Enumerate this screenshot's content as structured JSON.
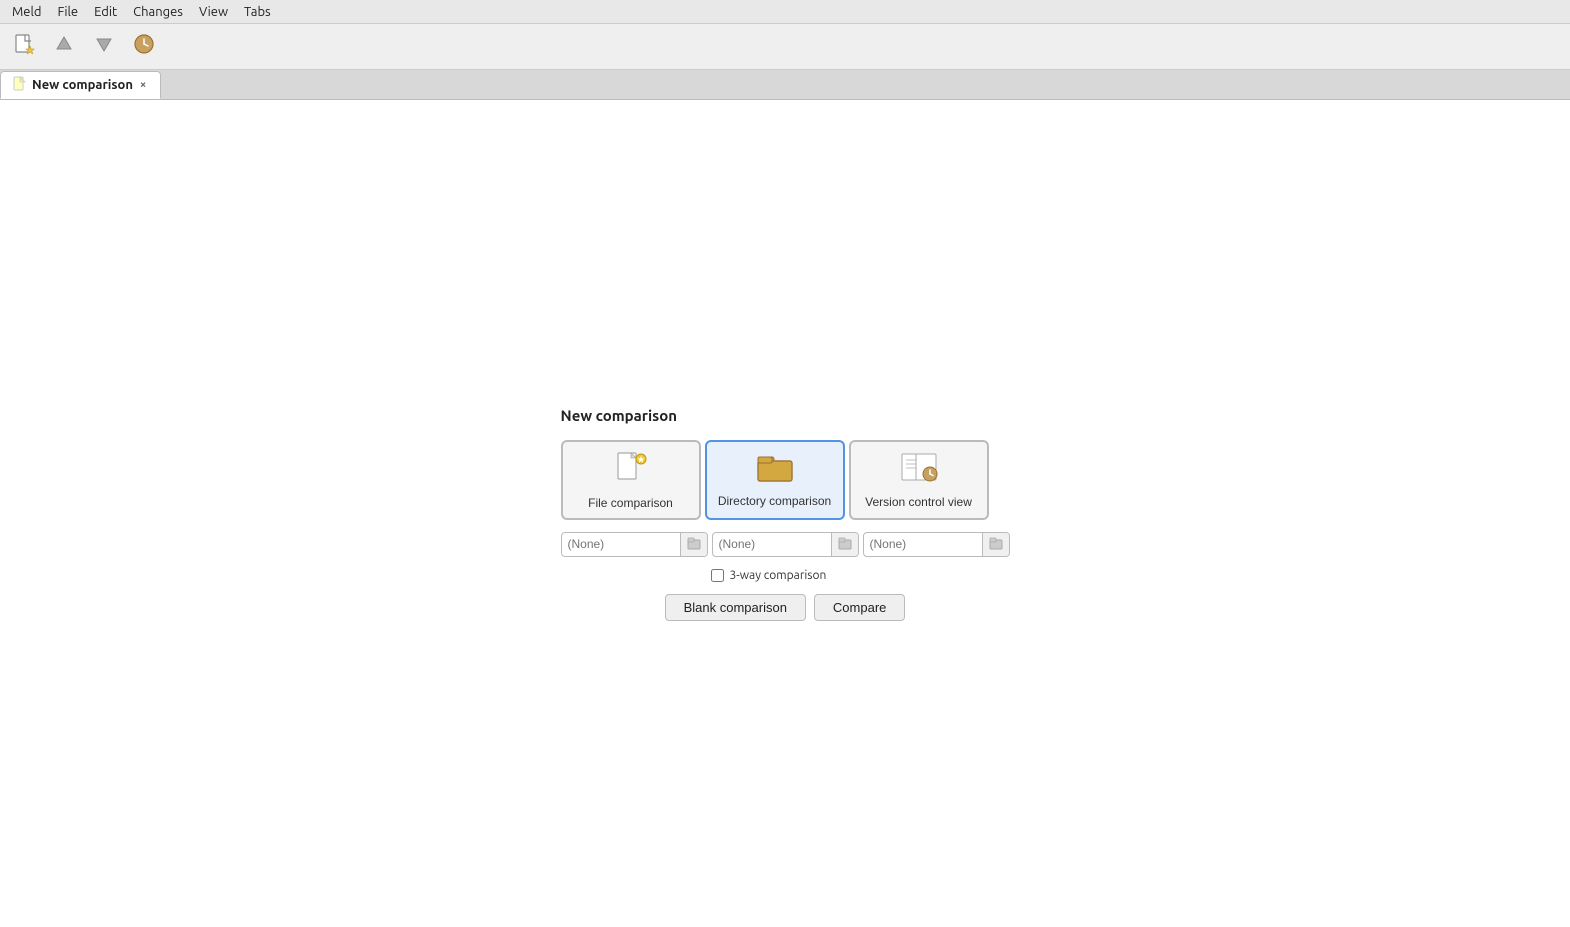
{
  "menubar": {
    "items": [
      "Meld",
      "File",
      "Edit",
      "Changes",
      "View",
      "Tabs"
    ]
  },
  "toolbar": {
    "buttons": [
      {
        "name": "new-icon",
        "symbol": "🗋",
        "tooltip": "New"
      },
      {
        "name": "up-icon",
        "symbol": "⬆",
        "tooltip": "Up"
      },
      {
        "name": "down-icon",
        "symbol": "⬇",
        "tooltip": "Down"
      },
      {
        "name": "info-icon",
        "symbol": "🕐",
        "tooltip": "Info"
      }
    ]
  },
  "tab": {
    "icon": "📄",
    "label": "New comparison",
    "close_label": "×"
  },
  "panel": {
    "title": "New comparison",
    "types": [
      {
        "id": "file",
        "label": "File comparison",
        "icon": "📄⭐"
      },
      {
        "id": "directory",
        "label": "Directory comparison",
        "icon": "📁"
      },
      {
        "id": "vcs",
        "label": "Version control view",
        "icon": "📋🕐"
      }
    ],
    "file_input": {
      "placeholder": "(None)",
      "browse_symbol": "🖿"
    },
    "dir_input": {
      "placeholder": "(None)",
      "browse_symbol": "🖿"
    },
    "vcs_input": {
      "placeholder": "(None)",
      "browse_symbol": "🖿"
    },
    "threeway_label": "3-way comparison",
    "buttons": {
      "blank": "Blank comparison",
      "compare": "Compare"
    }
  },
  "colors": {
    "selected_tab_bg": "#ffffff",
    "tab_bg": "#e8e8e8",
    "selected_type_border": "#5294e2"
  }
}
